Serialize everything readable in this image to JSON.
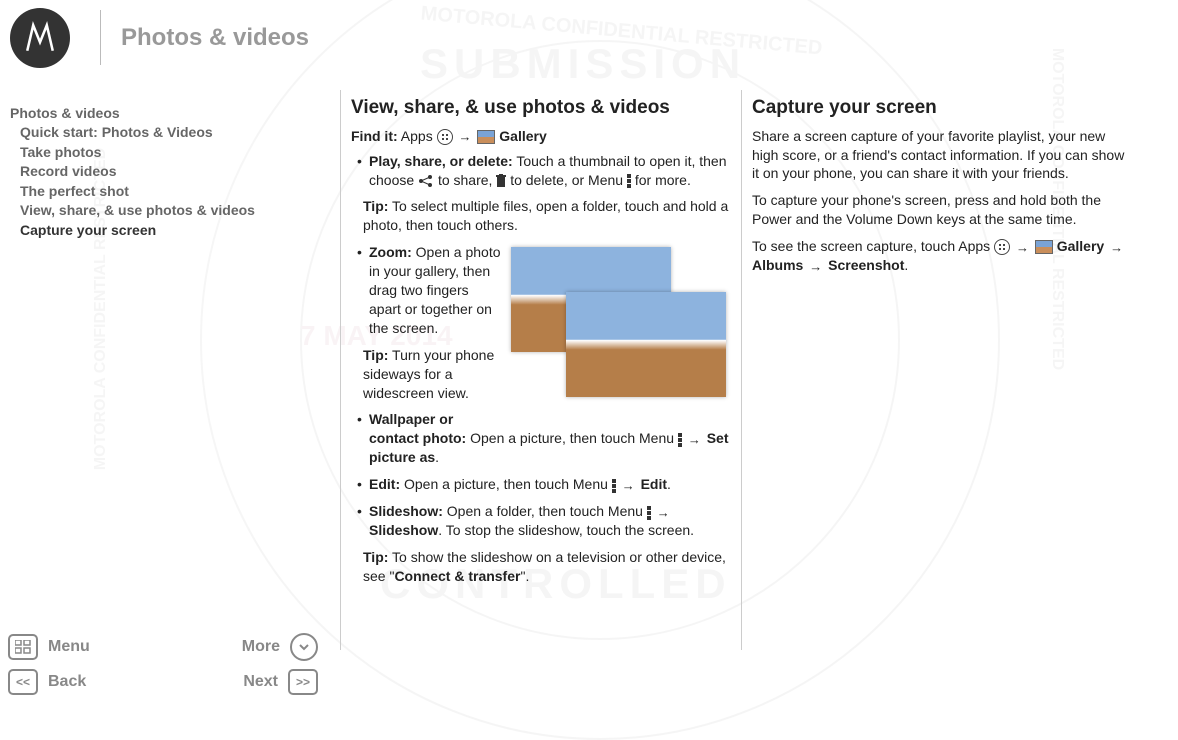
{
  "header": {
    "title": "Photos & videos"
  },
  "nav": {
    "title": "Photos & videos",
    "items": [
      {
        "label": "Quick start: Photos & Videos",
        "active": false
      },
      {
        "label": "Take photos",
        "active": false
      },
      {
        "label": "Record videos",
        "active": false
      },
      {
        "label": "The perfect shot",
        "active": false
      },
      {
        "label": "View, share, & use photos & videos",
        "active": false
      },
      {
        "label": "Capture your screen",
        "active": true
      }
    ]
  },
  "col1": {
    "heading": "View, share, & use photos & videos",
    "findit_label": "Find it:",
    "findit_apps": "Apps",
    "findit_gallery": "Gallery",
    "bullets": {
      "play": {
        "label": "Play, share, or delete:",
        "text1": "Touch a thumbnail to open it, then choose",
        "text2": "to share,",
        "text3": "to delete, or Menu",
        "text4": "for more."
      },
      "play_tip": {
        "label": "Tip:",
        "text": "To select multiple files, open a folder, touch and hold a photo, then touch others."
      },
      "zoom": {
        "label": "Zoom:",
        "text": "Open a photo in your gallery, then drag two fingers apart or together on the screen."
      },
      "zoom_tip": {
        "label": "Tip:",
        "text": "Turn your phone sideways for a widescreen view."
      },
      "wallpaper": {
        "label": "Wallpaper or contact photo:",
        "text": "Open a picture, then touch Menu",
        "action": "Set picture as"
      },
      "edit": {
        "label": "Edit:",
        "text": "Open a picture, then touch Menu",
        "action": "Edit"
      },
      "slideshow": {
        "label": "Slideshow:",
        "text1": "Open a folder, then touch Menu",
        "action": "Slideshow",
        "text2": "To stop the slideshow, touch the screen."
      },
      "slideshow_tip": {
        "label": "Tip:",
        "text1": "To show the slideshow on a television or other device, see \"",
        "link": "Connect & transfer",
        "text2": "\"."
      }
    },
    "period": "."
  },
  "col2": {
    "heading": "Capture your screen",
    "p1": "Share a screen capture of your favorite playlist, your new high score, or a friend's contact information. If you can show it on your phone, you can share it with your friends.",
    "p2": "To capture your phone's screen, press and hold both the Power and the Volume Down keys at the same time.",
    "p3_a": "To see the screen capture, touch Apps",
    "p3_gallery": "Gallery",
    "p3_albums": "Albums",
    "p3_screenshot": "Screenshot"
  },
  "bottom": {
    "menu": "Menu",
    "more": "More",
    "back": "Back",
    "next": "Next"
  },
  "watermark": {
    "date": "7 MAY 2014",
    "stamp": "MOTOROLA CONFIDENTIAL RESTRICTED",
    "center": "CONTROLLED",
    "sub": "SUBMISSION"
  }
}
